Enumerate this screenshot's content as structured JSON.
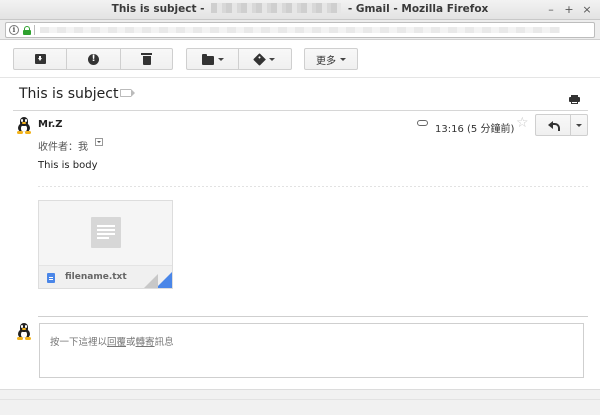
{
  "window": {
    "title_prefix": "This is subject -",
    "title_suffix": "- Gmail - Mozilla Firefox",
    "controls": [
      "–",
      "+",
      "×"
    ]
  },
  "urlbar": {
    "info_glyph": "i"
  },
  "toolbar": {
    "spam_glyph": "!",
    "more_label": "更多"
  },
  "thread": {
    "subject": "This is subject"
  },
  "message": {
    "sender": "Mr.Z",
    "recipients": "收件者：我",
    "timestamp": "13:16 (5 分鐘前)",
    "star_glyph": "☆",
    "body": "This is body"
  },
  "attachment": {
    "filename": "filename.txt",
    "icon": "text-file-icon"
  },
  "reply": {
    "hint_prefix": "按一下這裡以",
    "reply_link": "回覆",
    "or_text": "或",
    "forward_link": "轉寄",
    "hint_suffix": "訊息"
  },
  "colors": {
    "accent_blue": "#4a86e8",
    "lock_green": "#2ea12e"
  }
}
